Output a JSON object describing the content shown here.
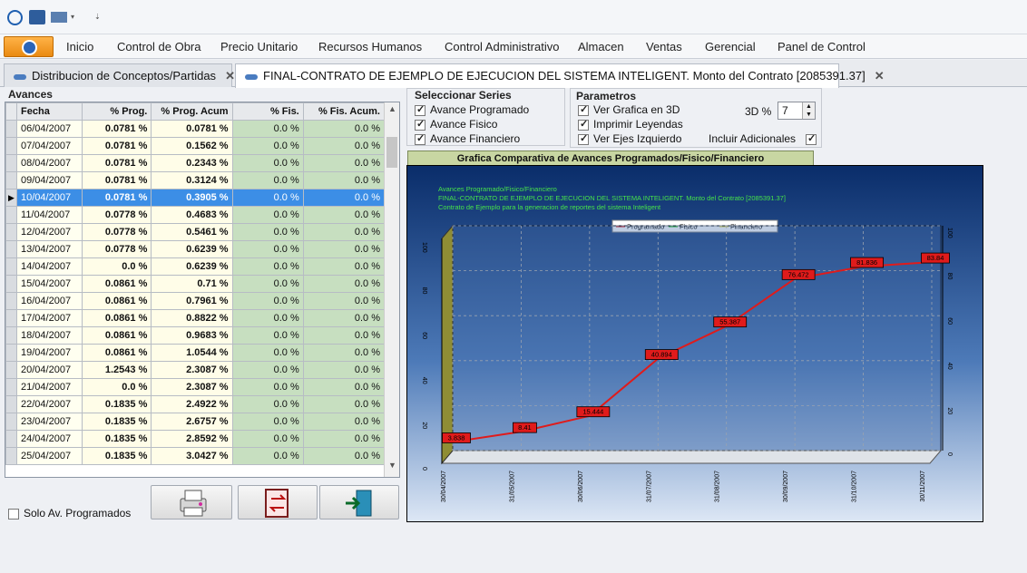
{
  "menu": {
    "items": [
      "Inicio",
      "Control de Obra",
      "Precio Unitario",
      "Recursos Humanos",
      "Control Administrativo",
      "Almacen",
      "Ventas",
      "Gerencial",
      "Panel de Control"
    ]
  },
  "tabs": [
    {
      "label": "Distribucion de Conceptos/Partidas"
    },
    {
      "label": "FINAL-CONTRATO DE EJEMPLO DE EJECUCION DEL SISTEMA INTELIGENT. Monto del Contrato [2085391.37]"
    }
  ],
  "avances": {
    "title": "Avances",
    "columns": [
      "Fecha",
      "% Prog.",
      "% Prog. Acum",
      "% Fis.",
      "% Fis. Acum."
    ],
    "rows": [
      [
        "06/04/2007",
        "0.0781 %",
        "0.0781 %",
        "0.0 %",
        "0.0 %"
      ],
      [
        "07/04/2007",
        "0.0781 %",
        "0.1562 %",
        "0.0 %",
        "0.0 %"
      ],
      [
        "08/04/2007",
        "0.0781 %",
        "0.2343 %",
        "0.0 %",
        "0.0 %"
      ],
      [
        "09/04/2007",
        "0.0781 %",
        "0.3124 %",
        "0.0 %",
        "0.0 %"
      ],
      [
        "10/04/2007",
        "0.0781 %",
        "0.3905 %",
        "0.0 %",
        "0.0 %"
      ],
      [
        "11/04/2007",
        "0.0778 %",
        "0.4683 %",
        "0.0 %",
        "0.0 %"
      ],
      [
        "12/04/2007",
        "0.0778 %",
        "0.5461 %",
        "0.0 %",
        "0.0 %"
      ],
      [
        "13/04/2007",
        "0.0778 %",
        "0.6239 %",
        "0.0 %",
        "0.0 %"
      ],
      [
        "14/04/2007",
        "0.0 %",
        "0.6239 %",
        "0.0 %",
        "0.0 %"
      ],
      [
        "15/04/2007",
        "0.0861 %",
        "0.71 %",
        "0.0 %",
        "0.0 %"
      ],
      [
        "16/04/2007",
        "0.0861 %",
        "0.7961 %",
        "0.0 %",
        "0.0 %"
      ],
      [
        "17/04/2007",
        "0.0861 %",
        "0.8822 %",
        "0.0 %",
        "0.0 %"
      ],
      [
        "18/04/2007",
        "0.0861 %",
        "0.9683 %",
        "0.0 %",
        "0.0 %"
      ],
      [
        "19/04/2007",
        "0.0861 %",
        "1.0544 %",
        "0.0 %",
        "0.0 %"
      ],
      [
        "20/04/2007",
        "1.2543 %",
        "2.3087 %",
        "0.0 %",
        "0.0 %"
      ],
      [
        "21/04/2007",
        "0.0 %",
        "2.3087 %",
        "0.0 %",
        "0.0 %"
      ],
      [
        "22/04/2007",
        "0.1835 %",
        "2.4922 %",
        "0.0 %",
        "0.0 %"
      ],
      [
        "23/04/2007",
        "0.1835 %",
        "2.6757 %",
        "0.0 %",
        "0.0 %"
      ],
      [
        "24/04/2007",
        "0.1835 %",
        "2.8592 %",
        "0.0 %",
        "0.0 %"
      ],
      [
        "25/04/2007",
        "0.1835 %",
        "3.0427 %",
        "0.0 %",
        "0.0 %"
      ]
    ],
    "selected_row": 4
  },
  "solo_label": "Solo Av. Programados",
  "series_panel": {
    "title": "Seleccionar Series",
    "items": [
      {
        "label": "Avance Programado",
        "checked": true
      },
      {
        "label": "Avance Fisico",
        "checked": true
      },
      {
        "label": "Avance Financiero",
        "checked": true
      }
    ]
  },
  "params_panel": {
    "title": "Parametros",
    "ver_3d": "Ver Grafica en 3D",
    "imprimir": "Imprimir Leyendas",
    "ejes": "Ver Ejes Izquierdo",
    "pct_label": "3D %",
    "pct_value": "7",
    "adicionales": "Incluir Adicionales"
  },
  "chart_data": {
    "type": "line",
    "title": "Grafica Comparativa de Avances Programados/Fisico/Financiero",
    "subtitle_lines": [
      "Avances Programado/Fisico/Financiero",
      "FINAL-CONTRATO DE EJEMPLO DE EJECUCION DEL SISTEMA INTELIGENT. Monto del Contrato [2085391.37]",
      "Contrato de Ejemplo para la generacion de reportes del sistema Inteligent"
    ],
    "legend": [
      "Programado",
      "Fisico",
      "Financiero"
    ],
    "legend_colors": [
      "#e01b1b",
      "#19c419",
      "#f2e84a"
    ],
    "x": [
      "30/04/2007",
      "31/05/2007",
      "30/06/2007",
      "31/07/2007",
      "31/08/2007",
      "30/09/2007",
      "31/10/2007",
      "30/11/2007"
    ],
    "series": [
      {
        "name": "Programado",
        "values": [
          3.838,
          8.41,
          15.444,
          40.894,
          55.387,
          76.472,
          81.836,
          83.84
        ]
      }
    ],
    "point_labels": [
      "3.838",
      "8.41",
      "15.444",
      "40.894",
      "55.387",
      "76.472",
      "81.836",
      "83.84"
    ],
    "ylim": [
      0,
      100
    ],
    "yticks": [
      0,
      20,
      40,
      60,
      80,
      100
    ],
    "grid": true,
    "colors": {
      "line": "#e01b1b",
      "label_bg": "#e01b1b",
      "floor": "#8f8d35"
    }
  }
}
